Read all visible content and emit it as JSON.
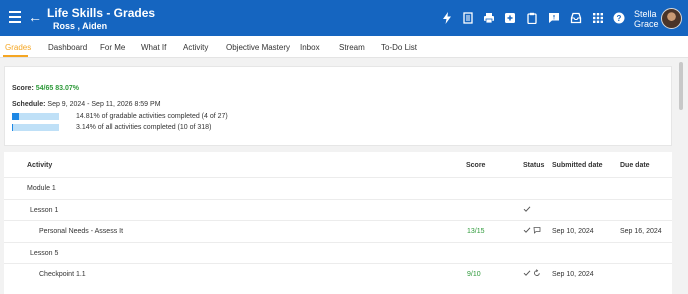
{
  "header": {
    "title": "Life Skills - Grades",
    "subtitle": "Ross , Aiden",
    "user_name_line1": "Stella",
    "user_name_line2": "Grace",
    "accent_color": "#1565c0"
  },
  "toolbar_icons": [
    "lightning-icon",
    "document-icon",
    "print-icon",
    "add-icon",
    "clipboard-icon",
    "message-icon",
    "inbox-icon",
    "apps-grid-icon",
    "help-icon"
  ],
  "tabs": [
    {
      "label": "Grades",
      "active": true
    },
    {
      "label": "Dashboard"
    },
    {
      "label": "For Me"
    },
    {
      "label": "What If"
    },
    {
      "label": "Activity"
    },
    {
      "label": "Objective Mastery"
    },
    {
      "label": "Inbox"
    },
    {
      "label": "Stream"
    },
    {
      "label": "To-Do List"
    }
  ],
  "summary": {
    "score_label": "Score:",
    "score_value": "54/65 83.07%",
    "schedule_label": "Schedule:",
    "schedule_value": "Sep 9, 2024 - Sep 11, 2026 8:59 PM",
    "progress": [
      {
        "percent": 14.81,
        "text": "14.81% of gradable activities completed (4 of 27)"
      },
      {
        "percent": 3.14,
        "text": "3.14% of all activities completed (10 of 318)"
      }
    ]
  },
  "table": {
    "headers": {
      "activity": "Activity",
      "score": "Score",
      "status": "Status",
      "submitted": "Submitted date",
      "due": "Due date"
    },
    "rows": [
      {
        "type": "module",
        "activity": "Module 1",
        "score": "",
        "status": [],
        "submitted": "",
        "due": ""
      },
      {
        "type": "lesson",
        "activity": "Lesson 1",
        "score": "",
        "status": [
          "check-icon"
        ],
        "submitted": "",
        "due": ""
      },
      {
        "type": "item",
        "activity": "Personal Needs - Assess It",
        "score": "13/15",
        "status": [
          "check-icon",
          "comment-icon"
        ],
        "submitted": "Sep 10, 2024",
        "due": "Sep 16, 2024"
      },
      {
        "type": "lesson",
        "activity": "Lesson 5",
        "score": "",
        "status": [],
        "submitted": "",
        "due": ""
      },
      {
        "type": "item",
        "activity": "Checkpoint 1.1",
        "score": "9/10",
        "status": [
          "check-icon",
          "retry-icon"
        ],
        "submitted": "Sep 10, 2024",
        "due": ""
      }
    ]
  }
}
